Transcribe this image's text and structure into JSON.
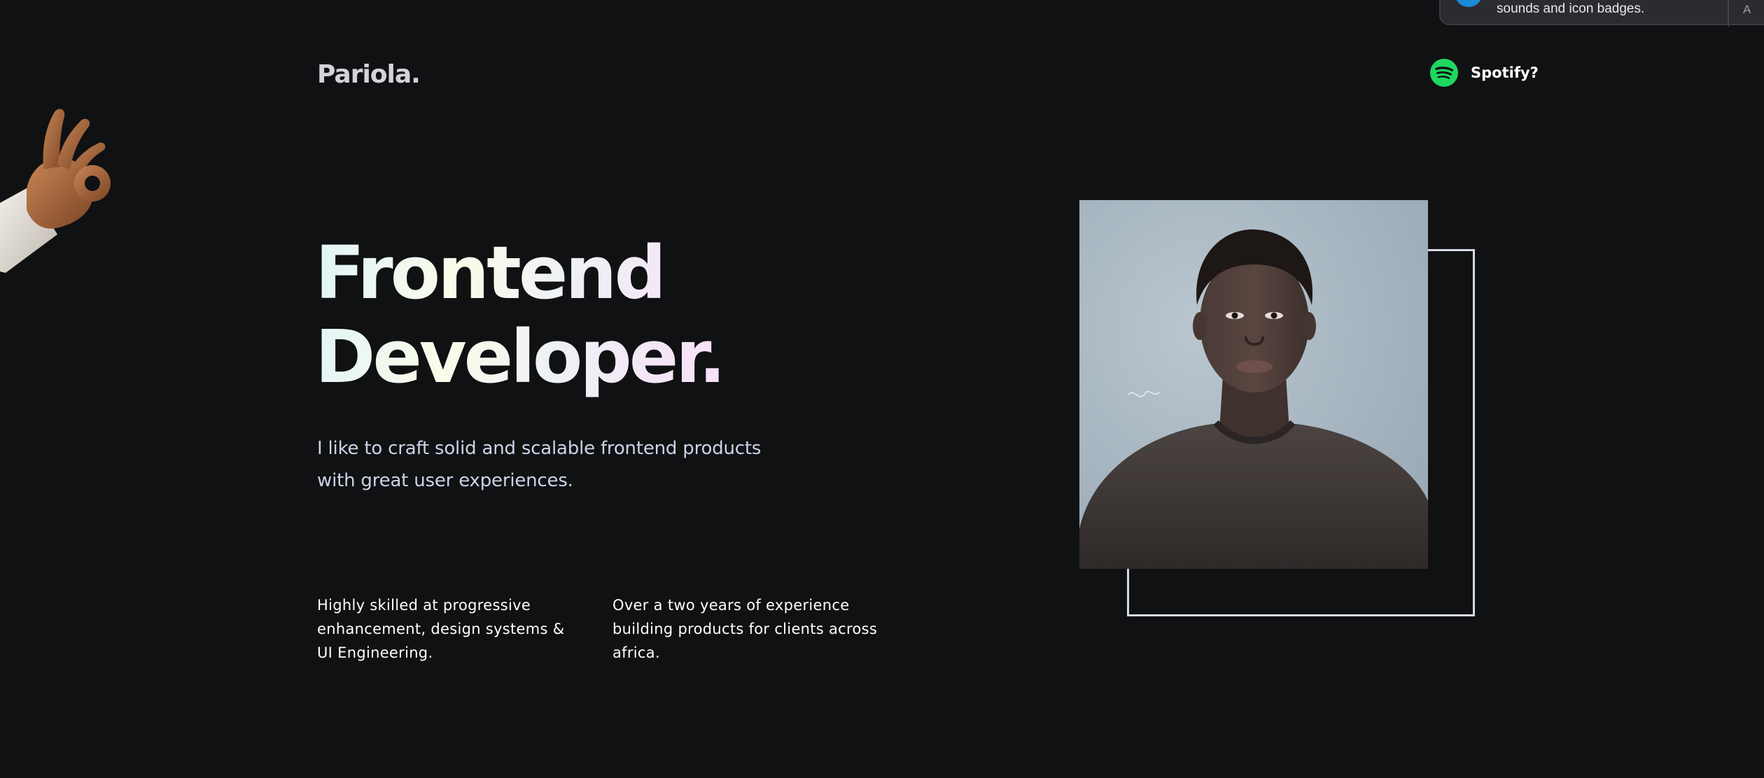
{
  "notification": {
    "text": "sounds and icon badges.",
    "action": "A"
  },
  "header": {
    "logo": "Pariola.",
    "spotify_label": "Spotify?"
  },
  "hero": {
    "title_line1": "Frontend",
    "title_line2": "Developer.",
    "subtitle": "I like to craft solid and scalable frontend products with great user experiences."
  },
  "blurbs": [
    "Highly skilled at progressive enhancement, design systems & UI Engineering.",
    "Over a two years of experience building products for clients across africa."
  ],
  "colors": {
    "background": "#101113",
    "spotify_green": "#1ed760",
    "frame": "#d7d9e6"
  },
  "icons": {
    "spotify": "spotify-icon",
    "decoration": "ok-hand-icon"
  }
}
